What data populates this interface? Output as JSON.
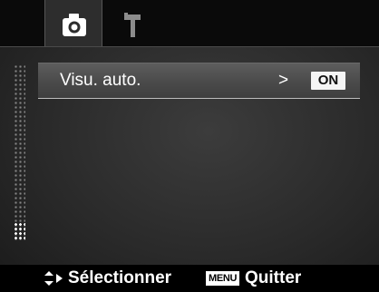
{
  "tabs": [
    {
      "name": "camera",
      "icon": "camera-icon",
      "active": true
    },
    {
      "name": "setup",
      "icon": "hammer-icon",
      "active": false
    }
  ],
  "menu": {
    "items": [
      {
        "label": "Visu. auto.",
        "arrow": ">",
        "value": "ON"
      }
    ]
  },
  "footer": {
    "select_label": "Sélectionner",
    "menu_key": "MENU",
    "quit_label": "Quitter"
  },
  "colors": {
    "active_tab": "#2d2d2d",
    "highlight_row": "#4a4a4a",
    "text": "#ffffff"
  }
}
